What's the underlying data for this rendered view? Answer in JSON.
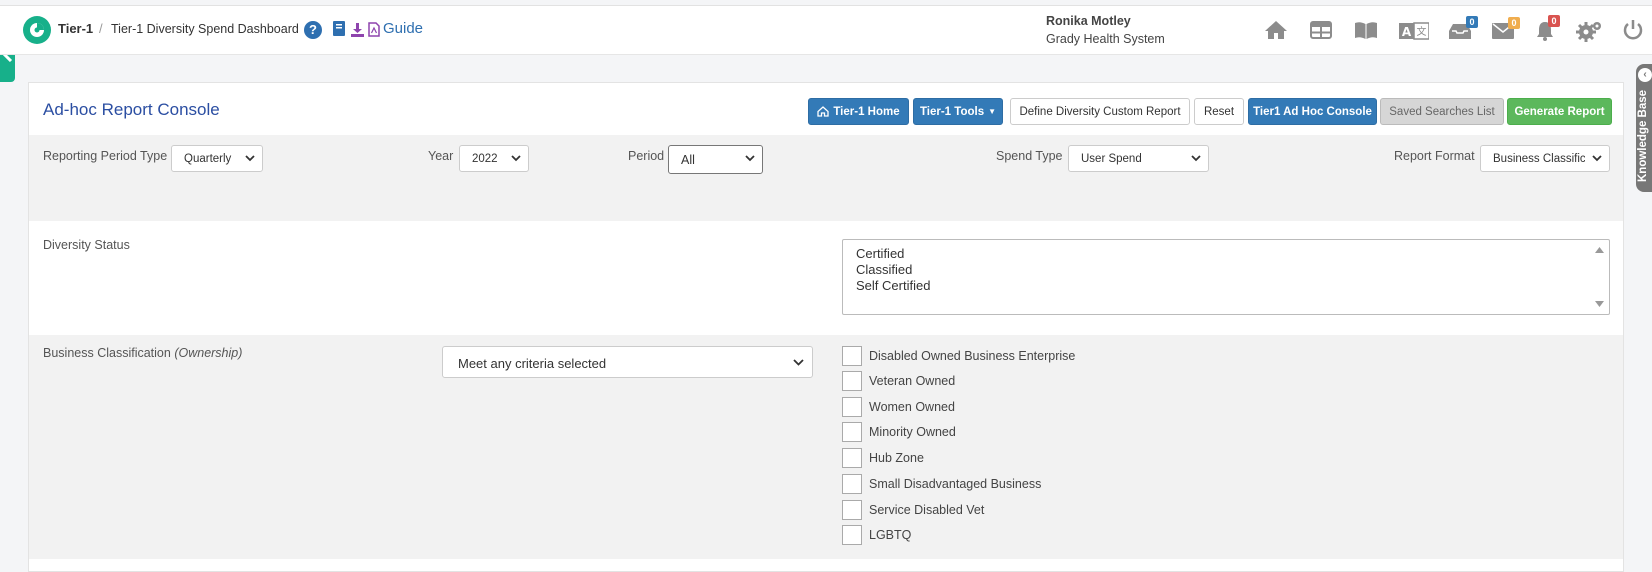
{
  "header": {
    "breadcrumb_root": "Tier-1",
    "breadcrumb_separator": "/",
    "breadcrumb_page": "Tier-1 Diversity Spend Dashboard",
    "help_glyph": "?",
    "guide_label": "Guide",
    "user_name": "Ronika Motley",
    "user_org": "Grady Health System",
    "icons": [
      "home-icon",
      "table-icon",
      "book-open-icon",
      "translate-icon",
      "inbox-icon",
      "envelope-icon",
      "bell-icon",
      "gears-icon",
      "power-icon"
    ],
    "badges": {
      "inbox": "0",
      "mail": "0",
      "alerts": "0"
    },
    "badge_colors": {
      "inbox": "#337ab7",
      "mail": "#f0ad4e",
      "alerts": "#d9534f"
    },
    "accent": "#17b08a"
  },
  "knowledge_base": {
    "label": "Knowledge Base"
  },
  "console": {
    "title": "Ad-hoc Report Console",
    "buttons": {
      "home": "Tier-1 Home",
      "tools": "Tier-1 Tools",
      "define": "Define Diversity Custom Report",
      "reset": "Reset",
      "adhoc": "Tier1 Ad Hoc Console",
      "saved": "Saved Searches List",
      "generate": "Generate Report"
    }
  },
  "filters": {
    "period_type": {
      "label": "Reporting Period Type",
      "value": "Quarterly"
    },
    "year": {
      "label": "Year",
      "value": "2022"
    },
    "period": {
      "label": "Period",
      "value": "All"
    },
    "spend_type": {
      "label": "Spend Type",
      "value": "User Spend"
    },
    "report_format": {
      "label": "Report Format",
      "value": "Business Classification"
    }
  },
  "diversity": {
    "label": "Diversity Status",
    "options": [
      "Certified",
      "Classified",
      "Self Certified"
    ]
  },
  "business_classification": {
    "label": "Business Classification",
    "label_suffix": "(Ownership)",
    "match_mode": "Meet any criteria selected",
    "options": [
      "Disabled Owned Business Enterprise",
      "Veteran Owned",
      "Women Owned",
      "Minority Owned",
      "Hub Zone",
      "Small Disadvantaged Business",
      "Service Disabled Vet",
      "LGBTQ"
    ]
  }
}
